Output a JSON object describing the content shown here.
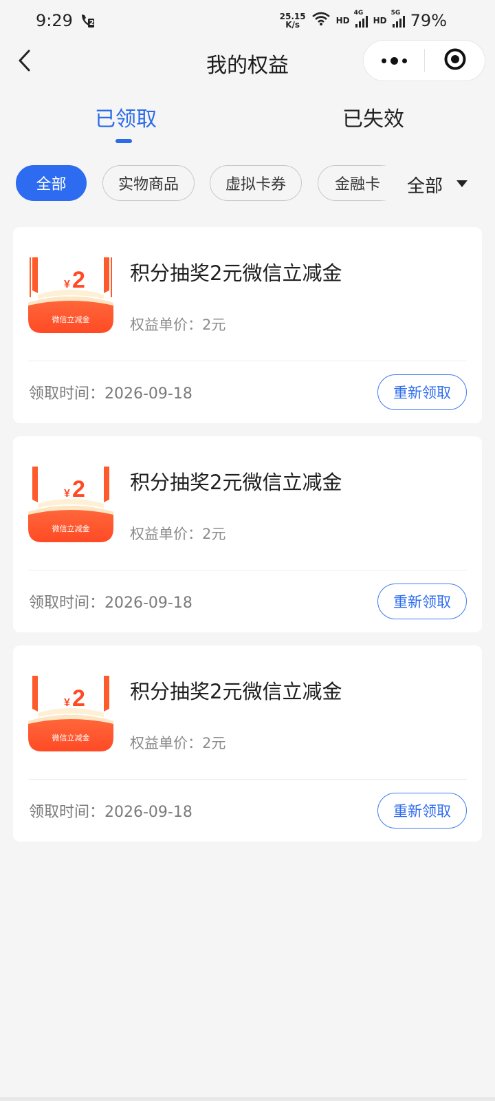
{
  "status_bar": {
    "time": "9:29",
    "call_badge": "2",
    "net_speed_value": "25.15",
    "net_speed_unit": "K/s",
    "hd1": "HD",
    "net1_type": "4G",
    "hd2": "HD",
    "net2_type": "5G",
    "battery": "79%"
  },
  "header": {
    "title": "我的权益",
    "back_icon": "chevron-left-icon",
    "more_icon": "more-dots-icon",
    "close_icon": "target-circle-icon"
  },
  "tabs": [
    {
      "label": "已领取",
      "active": true
    },
    {
      "label": "已失效",
      "active": false
    }
  ],
  "filters": {
    "chips": [
      {
        "label": "全部",
        "active": true
      },
      {
        "label": "实物商品",
        "active": false
      },
      {
        "label": "虚拟卡券",
        "active": false
      },
      {
        "label": "金融卡",
        "active": false
      }
    ],
    "select_label": "全部",
    "select_icon": "triangle-down-icon"
  },
  "coupon_image": {
    "currency": "¥",
    "amount": "2",
    "caption": "微信立减金"
  },
  "cards": [
    {
      "title": "积分抽奖2元微信立减金",
      "price": "权益单价：2元",
      "time": "领取时间：2026-09-18",
      "button": "重新领取"
    },
    {
      "title": "积分抽奖2元微信立减金",
      "price": "权益单价：2元",
      "time": "领取时间：2026-09-18",
      "button": "重新领取"
    },
    {
      "title": "积分抽奖2元微信立减金",
      "price": "权益单价：2元",
      "time": "领取时间：2026-09-18",
      "button": "重新领取"
    }
  ],
  "colors": {
    "accent": "#2d6cf0",
    "coupon_orange": "#ff5a2c",
    "coupon_cream": "#fdf0d5",
    "background": "#f5f5f5"
  }
}
